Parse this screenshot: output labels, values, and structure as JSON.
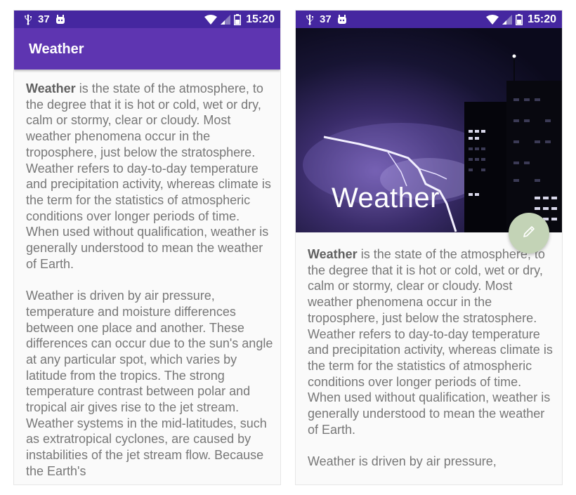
{
  "status_bar": {
    "notification_count": "37",
    "time": "15:20"
  },
  "left_screen": {
    "toolbar_title": "Weather",
    "paragraph1_bold": "Weather",
    "paragraph1_rest": " is the state of the atmosphere, to the degree that it is hot or cold, wet or dry, calm or stormy, clear or cloudy. Most weather phenomena occur in the troposphere, just below the stratosphere. Weather refers to day-to-day temperature and precipitation activity, whereas climate is the term for the statistics of atmospheric conditions over longer periods of time. When used without qualification, weather is generally understood to mean the weather of Earth.",
    "paragraph2": "Weather is driven by air pressure, temperature and moisture differences between one place and another. These differences can occur due to the sun's angle at any particular spot, which varies by latitude from the tropics. The strong temperature contrast between polar and tropical air gives rise to the jet stream. Weather systems in the mid-latitudes, such as extratropical cyclones, are caused by instabilities of the jet stream flow. Because the Earth's"
  },
  "right_screen": {
    "hero_title": "Weather",
    "paragraph1_bold": "Weather",
    "paragraph1_rest": " is the state of the atmosphere, to the degree that it is hot or cold, wet or dry, calm or stormy, clear or cloudy. Most weather phenomena occur in the troposphere, just below the stratosphere. Weather refers to day-to-day temperature and precipitation activity, whereas climate is the term for the statistics of atmospheric conditions over longer periods of time. When used without qualification, weather is generally understood to mean the weather of Earth.",
    "paragraph2": "Weather is driven by air pressure,",
    "fab_icon": "pencil-icon"
  },
  "colors": {
    "status_bar": "#4527a0",
    "toolbar": "#5e35b1",
    "fab": "#c3d3b6",
    "body_text": "#777777"
  }
}
